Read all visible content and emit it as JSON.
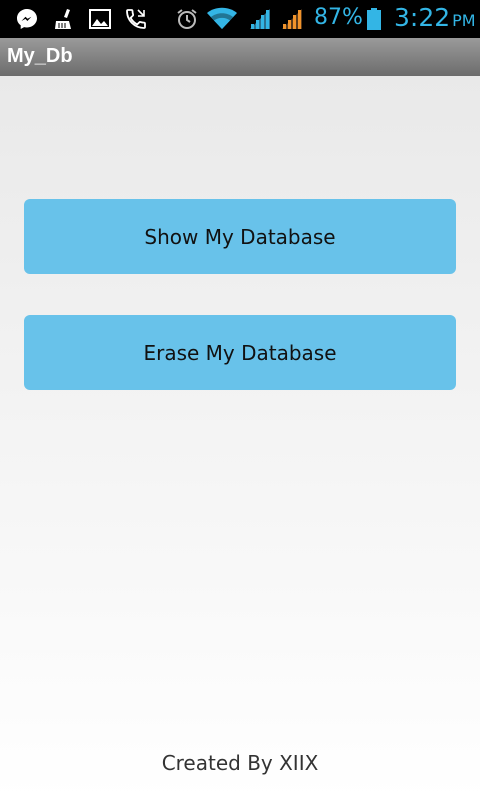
{
  "status_bar": {
    "icons": [
      "messenger-icon",
      "cleaner-icon",
      "gallery-icon",
      "call-icon",
      "alarm-icon",
      "wifi-icon",
      "signal-1-icon",
      "signal-2-icon",
      "battery-icon"
    ],
    "battery_percent": "87%",
    "time": "3:22",
    "ampm": "PM",
    "accent_color": "#33b5e5"
  },
  "app_bar": {
    "title": "My_Db"
  },
  "main": {
    "show_button_label": "Show My Database",
    "erase_button_label": "Erase My Database",
    "button_color": "#68c2ea"
  },
  "footer": {
    "credit": "Created By XIIX"
  }
}
